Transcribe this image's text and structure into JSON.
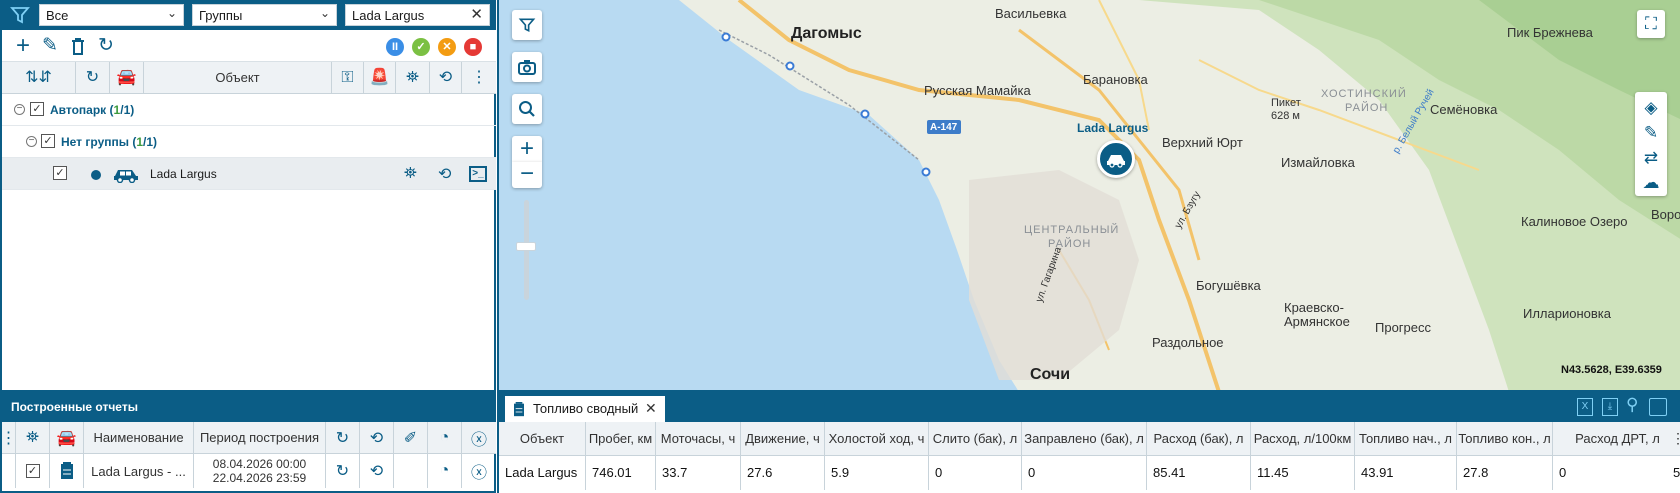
{
  "filters": {
    "scope": "Все",
    "groups": "Группы",
    "search_value": "Lada Largus"
  },
  "object_table": {
    "header_object": "Объект"
  },
  "tree": {
    "root_label": "Автопарк",
    "root_count_visible": "1",
    "root_count_total": "1",
    "group_label": "Нет группы",
    "group_count_visible": "1",
    "group_count_total": "1",
    "item_label": "Lada Largus"
  },
  "reports_panel": {
    "title": "Построенные отчеты",
    "headers": {
      "name": "Наименование",
      "period": "Период построения"
    },
    "row": {
      "name": "Lada Largus - ...",
      "period_start": "08.04.2026 00:00",
      "period_end": "22.04.2026 23:59"
    }
  },
  "map": {
    "labels": {
      "dagomys": "Дагомыс",
      "vasilevka": "Васильевка",
      "russkaya_mamayka": "Русская Мамайка",
      "baranovka": "Барановка",
      "verkhniy_yurt": "Верхний Юрт",
      "izmaylovka": "Измайловка",
      "khostinsky": "ХОСТИНСКИЙ",
      "rayon": "РАЙОН",
      "semenovka": "Семёновка",
      "pik_brezhneva": "Пик Брежнева",
      "piket": "Пикет",
      "piket_height": "628 м",
      "kalinovoe": "Калиновое Озеро",
      "voro": "Воро",
      "tsentralny": "ЦЕНТРАЛЬНЫЙ",
      "rayon2": "РАЙОН",
      "bogushevka": "Богушёвка",
      "kraevsko1": "Краевско-",
      "kraevsko2": "Армянское",
      "progress": "Прогресс",
      "illarionovka": "Илларионовка",
      "razdolnoe": "Раздольное",
      "sochi": "Сочи",
      "a147": "А-147",
      "street_gagarina": "ул. Гагарина",
      "street_bzugu": "ул. Бзугу",
      "street_belyi": "р. Белый Ручей"
    },
    "vehicle_label": "Lada Largus",
    "coordinates": "N43.5628, E39.6359"
  },
  "report_tab": {
    "label": "Топливо сводный"
  },
  "summary_table": {
    "headers": [
      "Объект",
      "Пробег, км",
      "Моточасы, ч",
      "Движение, ч",
      "Холостой ход, ч",
      "Слито (бак), л",
      "Заправлено (бак), л",
      "Расход (бак), л",
      "Расход, л/100км",
      "Топливо нач., л",
      "Топливо кон., л",
      "Расход ДРТ, л"
    ],
    "row": [
      "Lada Largus",
      "746.01",
      "33.7",
      "27.6",
      "5.9",
      "0",
      "0",
      "85.41",
      "11.45",
      "43.91",
      "27.8",
      "0"
    ],
    "overflow_value": "5"
  },
  "colors": {
    "primary": "#0b5d86",
    "status_pause": "#3a8ee6",
    "status_ok": "#7bc043",
    "status_warn": "#f39c12",
    "status_lock": "#e53935",
    "sea": "#b8daf2"
  }
}
